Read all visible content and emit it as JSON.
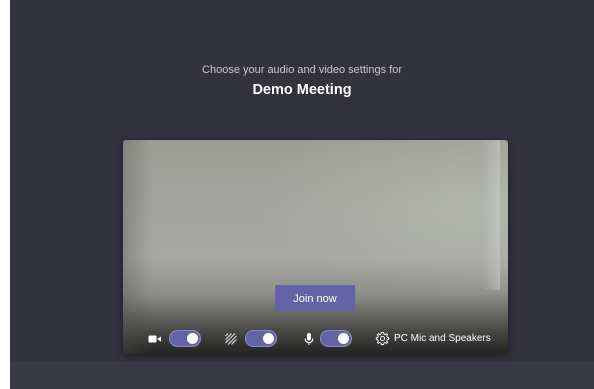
{
  "prejoin": {
    "subtitle": "Choose your audio and video settings for",
    "meeting_name": "Demo Meeting"
  },
  "preview": {
    "join_label": "Join now"
  },
  "controls": {
    "camera": {
      "icon": "video-camera-icon",
      "enabled": true
    },
    "background_blur": {
      "icon": "background-blur-icon",
      "enabled": true
    },
    "microphone": {
      "icon": "microphone-icon",
      "enabled": true
    },
    "device_settings": {
      "icon": "gear-icon",
      "label": "PC Mic and Speakers"
    }
  },
  "colors": {
    "window_bg": "#33323f",
    "accent": "#6264a7",
    "text_primary": "#ffffff",
    "text_secondary": "#c9c8d2"
  }
}
